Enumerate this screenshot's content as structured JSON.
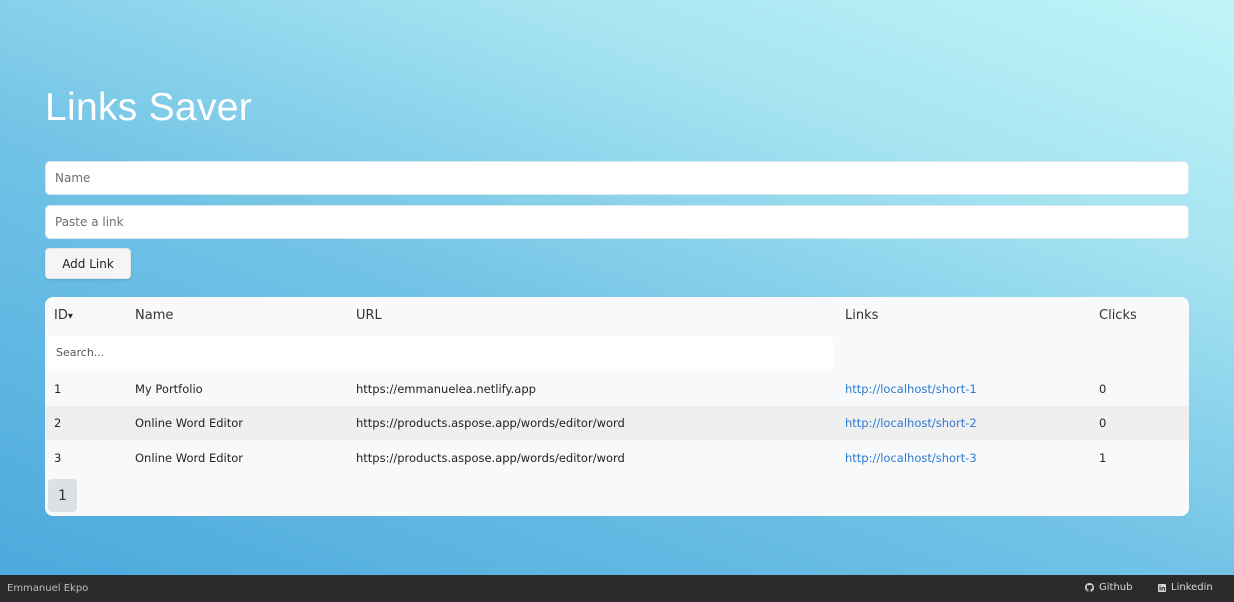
{
  "header": {
    "title": "Links Saver"
  },
  "form": {
    "name_placeholder": "Name",
    "link_placeholder": "Paste a link",
    "add_button_label": "Add Link"
  },
  "table": {
    "columns": {
      "id": "ID",
      "name": "Name",
      "url": "URL",
      "links": "Links",
      "clicks": "Clicks"
    },
    "sort_indicator": "▾",
    "search_placeholder": "Search...",
    "rows": [
      {
        "id": "1",
        "name": "My Portfolio",
        "url": "https://emmanuelea.netlify.app",
        "link": "http://localhost/short-1",
        "clicks": "0"
      },
      {
        "id": "2",
        "name": "Online Word Editor",
        "url": "https://products.aspose.app/words/editor/word",
        "link": "http://localhost/short-2",
        "clicks": "0"
      },
      {
        "id": "3",
        "name": "Online Word Editor",
        "url": "https://products.aspose.app/words/editor/word",
        "link": "http://localhost/short-3",
        "clicks": "1"
      }
    ],
    "current_page": "1"
  },
  "footer": {
    "author": "Emmanuel Ekpo",
    "github_label": "Github",
    "github_icon": "github-icon",
    "linkedin_label": "Linkedin",
    "linkedin_icon": "linkedin-icon"
  },
  "colors": {
    "link": "#2e7bd0",
    "footer_bg": "#2b2b2b",
    "title": "#ffffff"
  }
}
